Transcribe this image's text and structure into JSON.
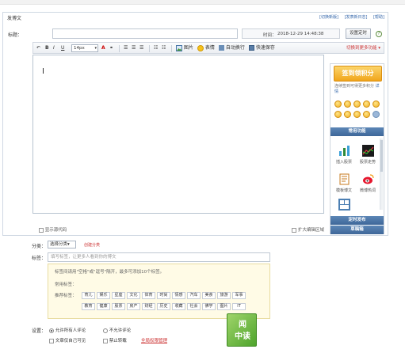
{
  "window": {
    "title": ""
  },
  "card": {
    "title": "发博文",
    "links": [
      "[切换新版]",
      "[发表新日志]",
      "[帮助]"
    ]
  },
  "title_row": {
    "label": "标题：",
    "input_value": "",
    "time_label": "时间：",
    "time_value": "2018-12-29 14:48:38",
    "timer_button": "设置定时",
    "help_icon": "?"
  },
  "toolbar": {
    "undo": "↶",
    "bold": "B",
    "italic": "I",
    "underline": "U",
    "font_size": "14px",
    "font_size_arrow": "▾",
    "color": "A",
    "link": "⚭",
    "align_left": "☰",
    "align_center": "☰",
    "align_right": "☰",
    "list_bullet": "☷",
    "list_number": "☷",
    "image": "图片",
    "emoticon": "表情",
    "autosave": "自动换行",
    "quicksave": "快速保存",
    "switch_more": "切换到更多功能 ▾"
  },
  "editor": {
    "show_source": "显示源代码",
    "expand": "扩大编辑区域"
  },
  "sidebar": {
    "sign_button": "签到领积分",
    "sign_tip": "连续签到可得更多积分",
    "sign_detail": "详情",
    "common_section": "常用功能",
    "tools": [
      {
        "label": "插入股票",
        "icon": "stock-chart-icon"
      },
      {
        "label": "股票走势",
        "icon": "stock-trend-icon"
      },
      {
        "label": "模板博文",
        "icon": "template-icon"
      },
      {
        "label": "微博热词",
        "icon": "weibo-icon"
      }
    ],
    "timed_publish": "定时发布",
    "draft_box": "草稿箱"
  },
  "form": {
    "category_label": "分类：",
    "category_value": "选择分类",
    "category_arrow": "▾",
    "create_category": "创建分类",
    "tag_label": "标签：",
    "tag_placeholder": "填写标签，让更多人看到你的博文",
    "tag_hint": "标签间请用\"空格\"或\"逗号\"隔开，最多可添加10个标签。",
    "common_tags_label": "常用标签：",
    "recommended_label": "推荐标签：",
    "recommended_tags_row1": [
      "育儿",
      "娱乐",
      "星座",
      "文化",
      "体育",
      "时尚",
      "情感",
      "汽车",
      "美食",
      "旅游",
      "军事"
    ],
    "recommended_tags_row2": [
      "教育",
      "健康",
      "股票",
      "房产",
      "财经",
      "历史",
      "收藏",
      "社会",
      "佛学",
      "图片",
      "IT"
    ],
    "settings_label": "设置：",
    "allow_comment": "允许所有人评论",
    "disallow_comment": "不允许评论",
    "private_visible": "文章仅自己可见",
    "no_repost": "禁止转载",
    "perm_manage": "全局权限管理"
  },
  "badge": {
    "line1": "闻",
    "line2": "中读"
  },
  "colors": {
    "accent_blue": "#3e6799",
    "sign_orange": "#f0a51c",
    "link_red": "#cc3333",
    "badge_green": "#4ea42c"
  }
}
